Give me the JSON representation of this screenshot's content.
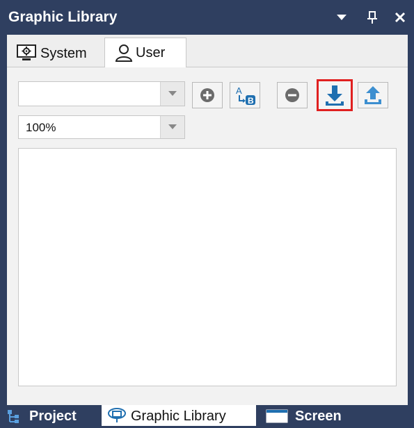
{
  "window": {
    "title": "Graphic Library",
    "controls": {
      "dropdown_icon": "dropdown-arrow-icon",
      "pin_icon": "pin-icon",
      "close_icon": "close-icon"
    }
  },
  "tabs": [
    {
      "label": "System",
      "icon": "monitor-gear-icon",
      "active": false
    },
    {
      "label": "User",
      "icon": "user-icon",
      "active": true
    }
  ],
  "toolbar": {
    "library_select": {
      "value": ""
    },
    "zoom_select": {
      "value": "100%"
    },
    "buttons": [
      {
        "name": "add",
        "icon": "add-circle-icon"
      },
      {
        "name": "rename",
        "icon": "rename-ab-icon"
      },
      {
        "name": "remove",
        "icon": "remove-circle-icon"
      },
      {
        "name": "import",
        "icon": "download-icon",
        "highlighted": true
      },
      {
        "name": "export",
        "icon": "upload-icon"
      }
    ]
  },
  "bottom_tabs": [
    {
      "label": "Project",
      "icon": "project-tree-icon",
      "active": false
    },
    {
      "label": "Graphic Library",
      "icon": "graphic-library-icon",
      "active": true
    },
    {
      "label": "Screen",
      "icon": "screen-icon",
      "active": false
    }
  ],
  "colors": {
    "titlebar": "#2f3f60",
    "accent_blue": "#1f6fb0",
    "highlight_red": "#e02020"
  }
}
